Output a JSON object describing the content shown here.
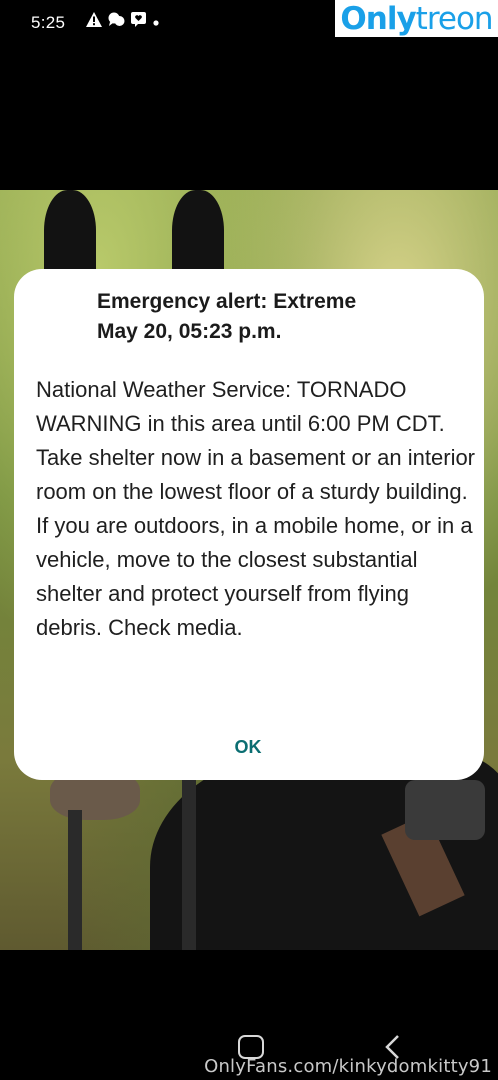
{
  "status_bar": {
    "time": "5:25",
    "icons": [
      "warning-icon",
      "chat-bubbles-icon",
      "message-heart-icon",
      "dot-icon"
    ]
  },
  "watermark": {
    "logo_part1": "Only",
    "logo_part2": "treon",
    "url": "OnlyFans.com/kinkydomkitty91",
    "logo_color": "#1aa0e8"
  },
  "alert": {
    "title_line1": "Emergency alert: Extreme",
    "title_line2": "May 20, 05:23 p.m.",
    "message": "National Weather Service: TORNADO WARNING in this area until 6:00 PM CDT. Take shelter now in a basement or an interior room on the lowest floor of a sturdy building. If you are outdoors, in a mobile home, or in a vehicle, move to the closest substantial shelter and protect yourself from flying debris. Check media.",
    "ok_label": "OK",
    "accent_color": "#0b6e72"
  },
  "nav_bar": {
    "home_icon": "home-icon",
    "back_icon": "back-chevron-icon"
  }
}
